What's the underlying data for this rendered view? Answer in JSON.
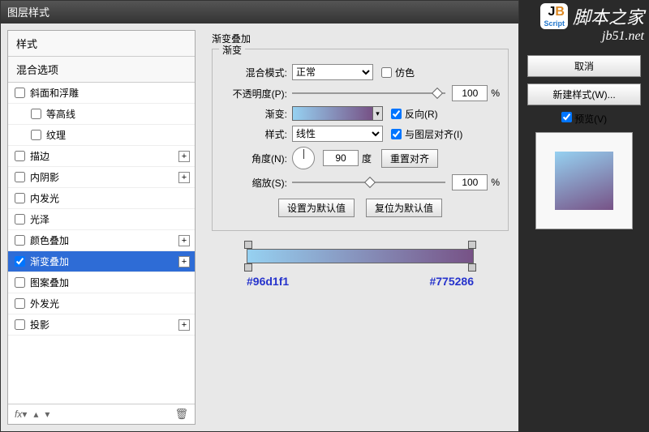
{
  "window": {
    "title": "图层样式"
  },
  "left": {
    "style_header": "样式",
    "blend_header": "混合选项",
    "items": [
      {
        "label": "斜面和浮雕",
        "checked": false,
        "plus": false,
        "indent": 0
      },
      {
        "label": "等高线",
        "checked": false,
        "plus": false,
        "indent": 1
      },
      {
        "label": "纹理",
        "checked": false,
        "plus": false,
        "indent": 1
      },
      {
        "label": "描边",
        "checked": false,
        "plus": true,
        "indent": 0
      },
      {
        "label": "内阴影",
        "checked": false,
        "plus": true,
        "indent": 0
      },
      {
        "label": "内发光",
        "checked": false,
        "plus": false,
        "indent": 0
      },
      {
        "label": "光泽",
        "checked": false,
        "plus": false,
        "indent": 0
      },
      {
        "label": "颜色叠加",
        "checked": false,
        "plus": true,
        "indent": 0
      },
      {
        "label": "渐变叠加",
        "checked": true,
        "plus": true,
        "indent": 0,
        "selected": true
      },
      {
        "label": "图案叠加",
        "checked": false,
        "plus": false,
        "indent": 0
      },
      {
        "label": "外发光",
        "checked": false,
        "plus": false,
        "indent": 0
      },
      {
        "label": "投影",
        "checked": false,
        "plus": true,
        "indent": 0
      }
    ],
    "fx_label": "fx"
  },
  "center": {
    "title": "渐变叠加",
    "group": "渐变",
    "blend_mode_label": "混合模式:",
    "blend_mode_value": "正常",
    "dither_label": "仿色",
    "opacity_label": "不透明度(P):",
    "opacity_value": "100",
    "opacity_unit": "%",
    "gradient_label": "渐变:",
    "reverse_label": "反向(R)",
    "style_label": "样式:",
    "style_value": "线性",
    "align_label": "与图层对齐(I)",
    "angle_label": "角度(N):",
    "angle_value": "90",
    "angle_unit": "度",
    "reset_align": "重置对齐",
    "scale_label": "缩放(S):",
    "scale_value": "100",
    "scale_unit": "%",
    "make_default": "设置为默认值",
    "reset_default": "复位为默认值",
    "hex_left": "#96d1f1",
    "hex_right": "#775286"
  },
  "right": {
    "cancel": "取消",
    "new_style": "新建样式(W)...",
    "preview": "预览(V)"
  },
  "watermark": {
    "badge1": "J",
    "badge2": "B",
    "script": "Script",
    "cn": "脚本之家",
    "url": "jb51.net"
  }
}
